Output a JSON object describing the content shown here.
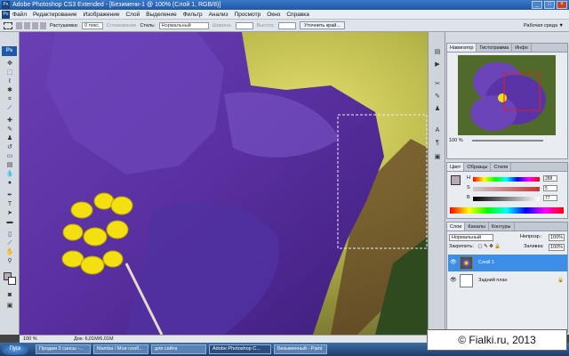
{
  "window": {
    "title": "Adobe Photoshop CS3 Extended - [Безимени-1 @ 100% (Слой 1, RGB/8)]",
    "app_icon": "Ps"
  },
  "menu": [
    "Файл",
    "Редактирование",
    "Изображение",
    "Слой",
    "Выделение",
    "Фильтр",
    "Анализ",
    "Просмотр",
    "Окно",
    "Справка"
  ],
  "options": {
    "feather_label": "Растушевка:",
    "feather_value": "0 пикс.",
    "antialias": "Сглаживание",
    "style_label": "Стиль:",
    "style_value": "Нормальный",
    "width_label": "Ширина:",
    "height_label": "Высота:",
    "refine_button": "Уточнить край...",
    "workspace": "Рабочая среда ▼"
  },
  "tools": {
    "logo": "Ps"
  },
  "status": {
    "zoom": "100 %",
    "doc": "Док: 6,01M/6,01M"
  },
  "navigator": {
    "tabs": [
      "Навигатор",
      "Гистограмма",
      "Инфо"
    ],
    "zoom": "100 %"
  },
  "color": {
    "tabs": [
      "Цвет",
      "Образцы",
      "Стили"
    ],
    "channels": [
      {
        "label": "H",
        "value": "288"
      },
      {
        "label": "S",
        "value": "5"
      },
      {
        "label": "B",
        "value": "77"
      }
    ]
  },
  "layers": {
    "tabs": [
      "Слои",
      "Каналы",
      "Контуры"
    ],
    "blend": "Нормальный",
    "opacity_label": "Непрозр.:",
    "opacity_value": "100%",
    "lock_label": "Закрепить:",
    "fill_label": "Заливка:",
    "fill_value": "100%",
    "items": [
      {
        "name": "Слой 1",
        "selected": true
      },
      {
        "name": "Задний план",
        "selected": false
      }
    ]
  },
  "taskbar": {
    "start": "Пуск",
    "items": [
      "Продам 3 сансы -...",
      "Mamba / Мои сооб...",
      "для сайта",
      "Adobe Photoshop C...",
      "Безымянный - Paint"
    ]
  },
  "watermark": "© Fialki.ru, 2013"
}
